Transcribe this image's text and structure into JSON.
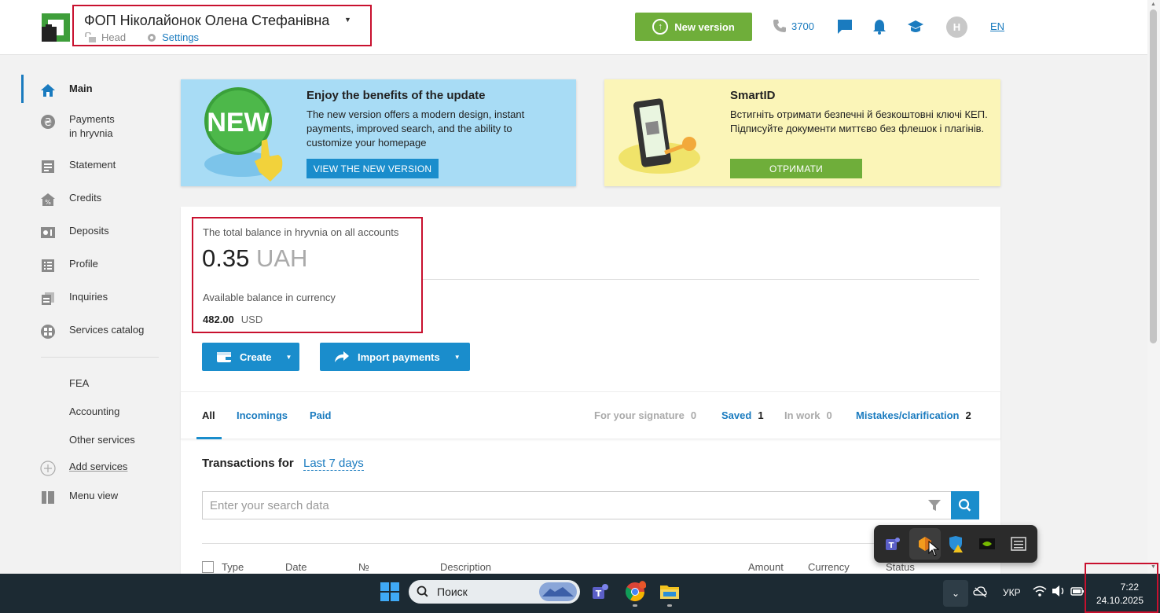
{
  "header": {
    "company_name": "ФОП Ніколайонок Олена Стефанівна",
    "role": "Head",
    "settings_label": "Settings",
    "new_version_label": "New version",
    "phone": "3700",
    "avatar_initial": "H",
    "language": "EN"
  },
  "sidebar": {
    "items": [
      {
        "label": "Main",
        "icon": "home-icon"
      },
      {
        "label": "Payments\nin hryvnia",
        "icon": "hryvnia-icon"
      },
      {
        "label": "Statement",
        "icon": "statement-icon"
      },
      {
        "label": "Credits",
        "icon": "credits-icon"
      },
      {
        "label": "Deposits",
        "icon": "deposits-icon"
      },
      {
        "label": "Profile",
        "icon": "profile-icon"
      },
      {
        "label": "Inquiries",
        "icon": "inquiries-icon"
      },
      {
        "label": "Services catalog",
        "icon": "services-catalog-icon"
      }
    ],
    "extra": [
      "FEA",
      "Accounting",
      "Other services"
    ],
    "add_services": "Add services",
    "menu_view": "Menu view"
  },
  "promo_new": {
    "badge": "NEW",
    "title": "Enjoy the benefits of the update",
    "text": "The new version offers a modern design, instant payments, improved search, and the ability to customize your homepage",
    "button": "VIEW THE NEW VERSION",
    "color": "#a8dcf5"
  },
  "promo_smartid": {
    "title": "SmartID",
    "text": "Встигніть отримати безпечні й безкоштовні ключі КЕП. Підписуйте документи миттєво без флешок і плагінів.",
    "button": "ОТРИМАТИ",
    "color": "#fbf5b8"
  },
  "balance": {
    "total_label": "The total balance in hryvnia on all accounts",
    "total_amount": "0.35",
    "total_currency": "UAH",
    "available_label": "Available balance in currency",
    "available_amount": "482.00",
    "available_currency": "USD"
  },
  "actions": {
    "create": "Create",
    "import": "Import payments"
  },
  "tabs": [
    "All",
    "Incomings",
    "Paid"
  ],
  "status_tabs": [
    {
      "label": "For your signature",
      "count": "0"
    },
    {
      "label": "Saved",
      "count": "1"
    },
    {
      "label": "In work",
      "count": "0"
    },
    {
      "label": "Mistakes/clarification",
      "count": "2"
    }
  ],
  "transactions": {
    "label": "Transactions for",
    "period": "Last 7 days",
    "search_placeholder": "Enter your search data"
  },
  "table_headers": [
    "Type",
    "Date",
    "№",
    "Description",
    "Amount",
    "Currency",
    "Status"
  ],
  "taskbar": {
    "search_label": "Поиск",
    "language": "УКР",
    "time": "7:22",
    "date": "24.10.2025"
  },
  "colors": {
    "accent": "#1a8dcc",
    "brand_green": "#6fae3a",
    "highlight_red": "#c8102e"
  }
}
